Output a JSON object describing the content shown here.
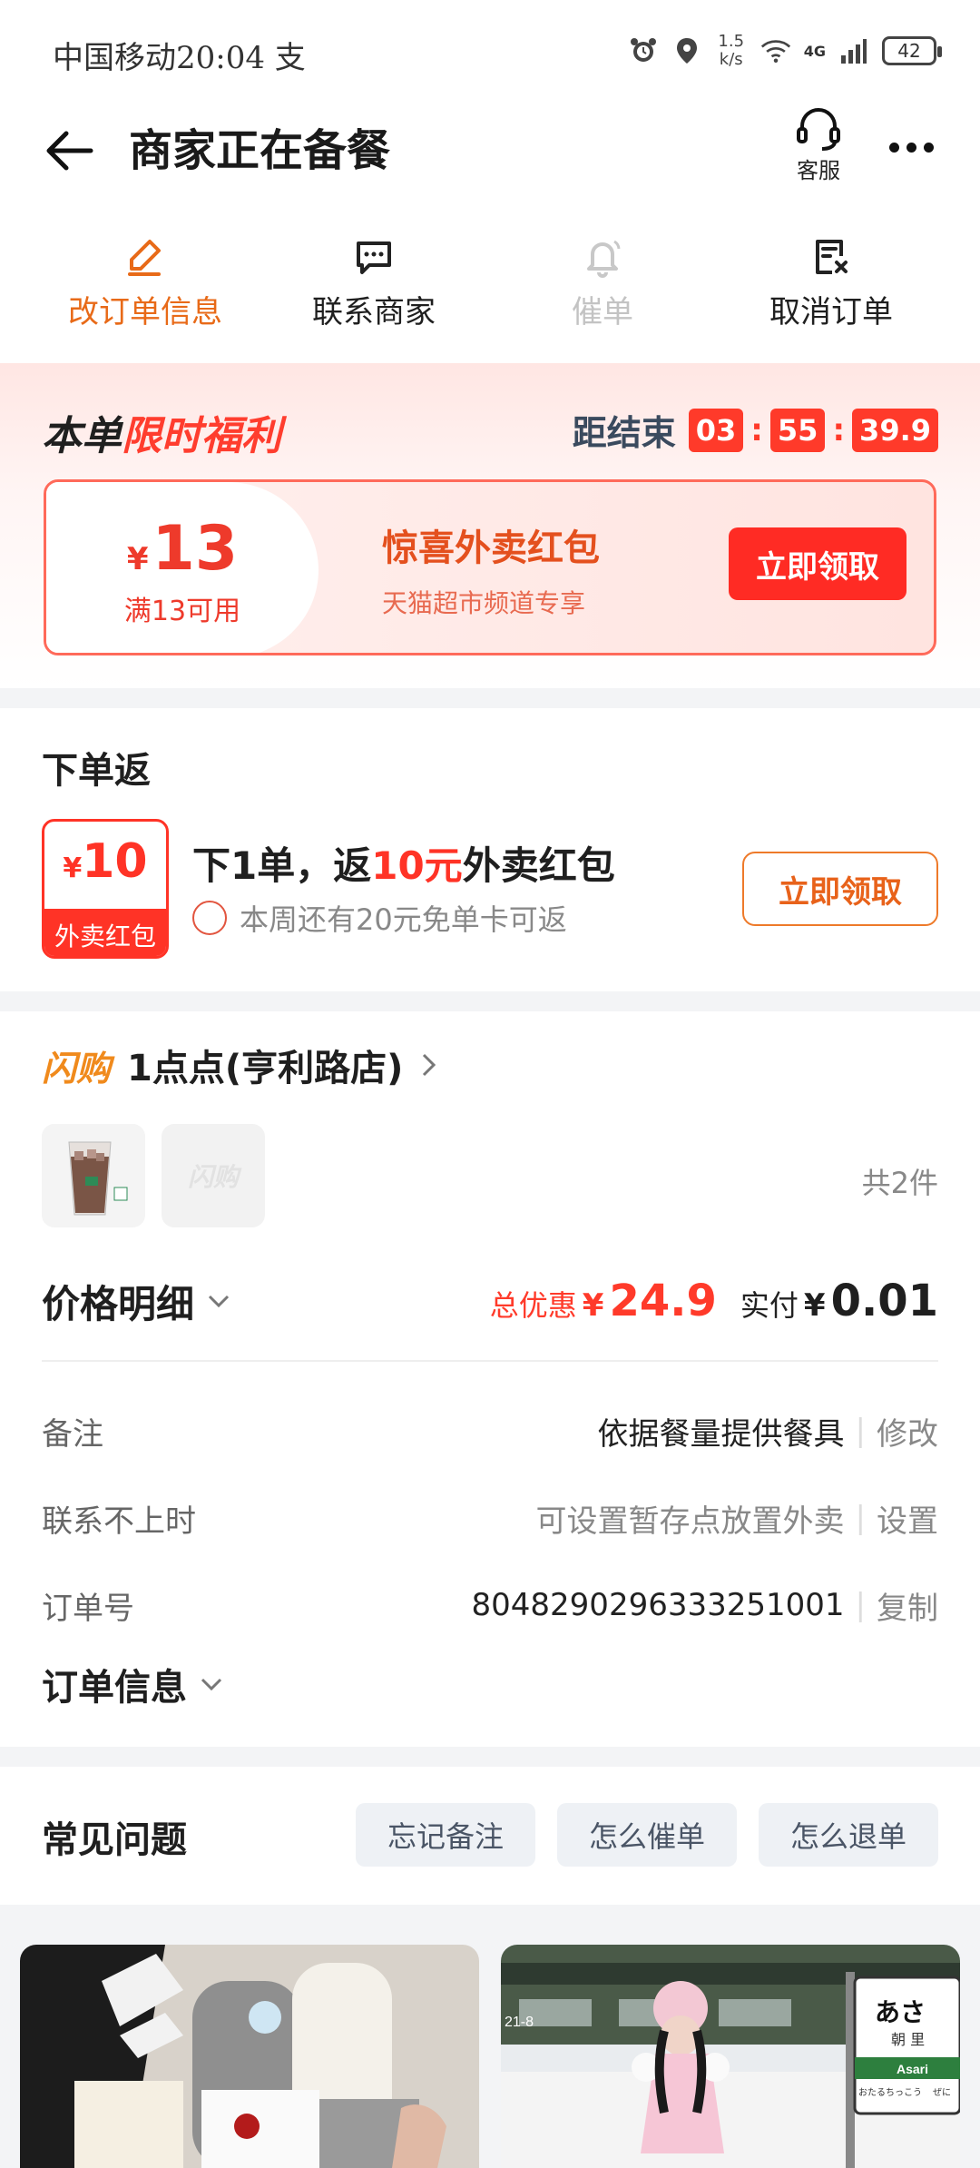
{
  "status_bar": {
    "carrier_time": "中国移动20:04 支",
    "speed_top": "1.5",
    "speed_bottom": "k/s",
    "network": "4G",
    "battery": "42"
  },
  "header": {
    "title": "商家正在备餐",
    "service_label": "客服"
  },
  "actions": [
    {
      "label": "改订单信息",
      "icon": "edit-icon"
    },
    {
      "label": "联系商家",
      "icon": "chat-icon"
    },
    {
      "label": "催单",
      "icon": "bell-icon"
    },
    {
      "label": "取消订单",
      "icon": "cancel-doc-icon"
    }
  ],
  "promo": {
    "title_black": "本单",
    "title_red": "限时福利",
    "countdown_label": "距结束",
    "countdown": {
      "h": "03",
      "m": "55",
      "s": "39.9"
    },
    "coupon": {
      "yen": "¥",
      "amount": "13",
      "condition": "满13可用",
      "title": "惊喜外卖红包",
      "subtitle": "天猫超市频道专享",
      "button": "立即领取"
    }
  },
  "rebate": {
    "title": "下单返",
    "coupon_yen": "¥",
    "coupon_amount": "10",
    "coupon_label": "外卖红包",
    "text_a": "下1单，返",
    "text_red": "10元",
    "text_b": "外卖红包",
    "subtext": "本周还有20元免单卡可返",
    "button": "立即领取"
  },
  "order": {
    "brand": "闪购",
    "store": "1点点(亨利路店)",
    "placeholder_brand": "闪购",
    "quantity": "共2件",
    "price_label": "价格明细",
    "discount_label": "总优惠",
    "discount_yen": "¥",
    "discount": "24.9",
    "paid_label": "实付",
    "paid_yen": "¥",
    "paid": "0.01",
    "rows": [
      {
        "key": "备注",
        "value": "依据餐量提供餐具",
        "action": "修改"
      },
      {
        "key": "联系不上时",
        "value": "可设置暂存点放置外卖",
        "action": "设置"
      },
      {
        "key": "订单号",
        "value": "8048290296333251001",
        "action": "复制"
      }
    ],
    "order_info_label": "订单信息"
  },
  "faq": {
    "title": "常见问题",
    "chips": [
      "忘记备注",
      "怎么催单",
      "怎么退单"
    ]
  },
  "feed": {
    "station_sign_main": "あさ",
    "station_sign_kanji": "朝 里",
    "station_sign_romaji": "Asari",
    "station_prev": "おたるちっこう",
    "station_next": "ぜに",
    "sign_number": "21-8"
  },
  "colors": {
    "orange": "#e86a18",
    "red": "#ff3a2a",
    "slate": "#3a4a5e"
  }
}
